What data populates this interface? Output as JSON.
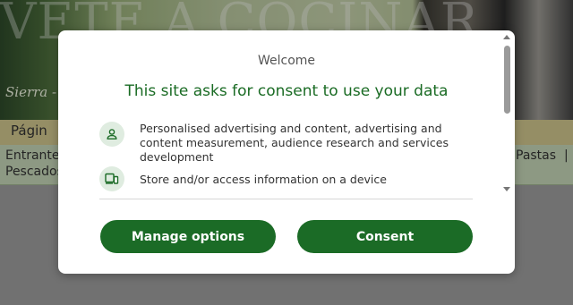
{
  "site": {
    "hero_title": "VETE A COCINAR",
    "hero_subtitle": "Sierra -",
    "nav_home": "Págin",
    "menu_left_1": "Entrante",
    "menu_left_2": "Pescados",
    "menu_right": "Pastas  |"
  },
  "dialog": {
    "welcome": "Welcome",
    "headline": "This site asks for consent to use your data",
    "purposes": [
      {
        "icon": "person-icon",
        "text": "Personalised advertising and content, advertising and content measurement, audience research and services development"
      },
      {
        "icon": "device-icon",
        "text": "Store and/or access information on a device"
      }
    ],
    "buttons": {
      "manage": "Manage options",
      "consent": "Consent"
    }
  },
  "colors": {
    "accent": "#1b6b26",
    "icon_bg": "#dfece0"
  }
}
